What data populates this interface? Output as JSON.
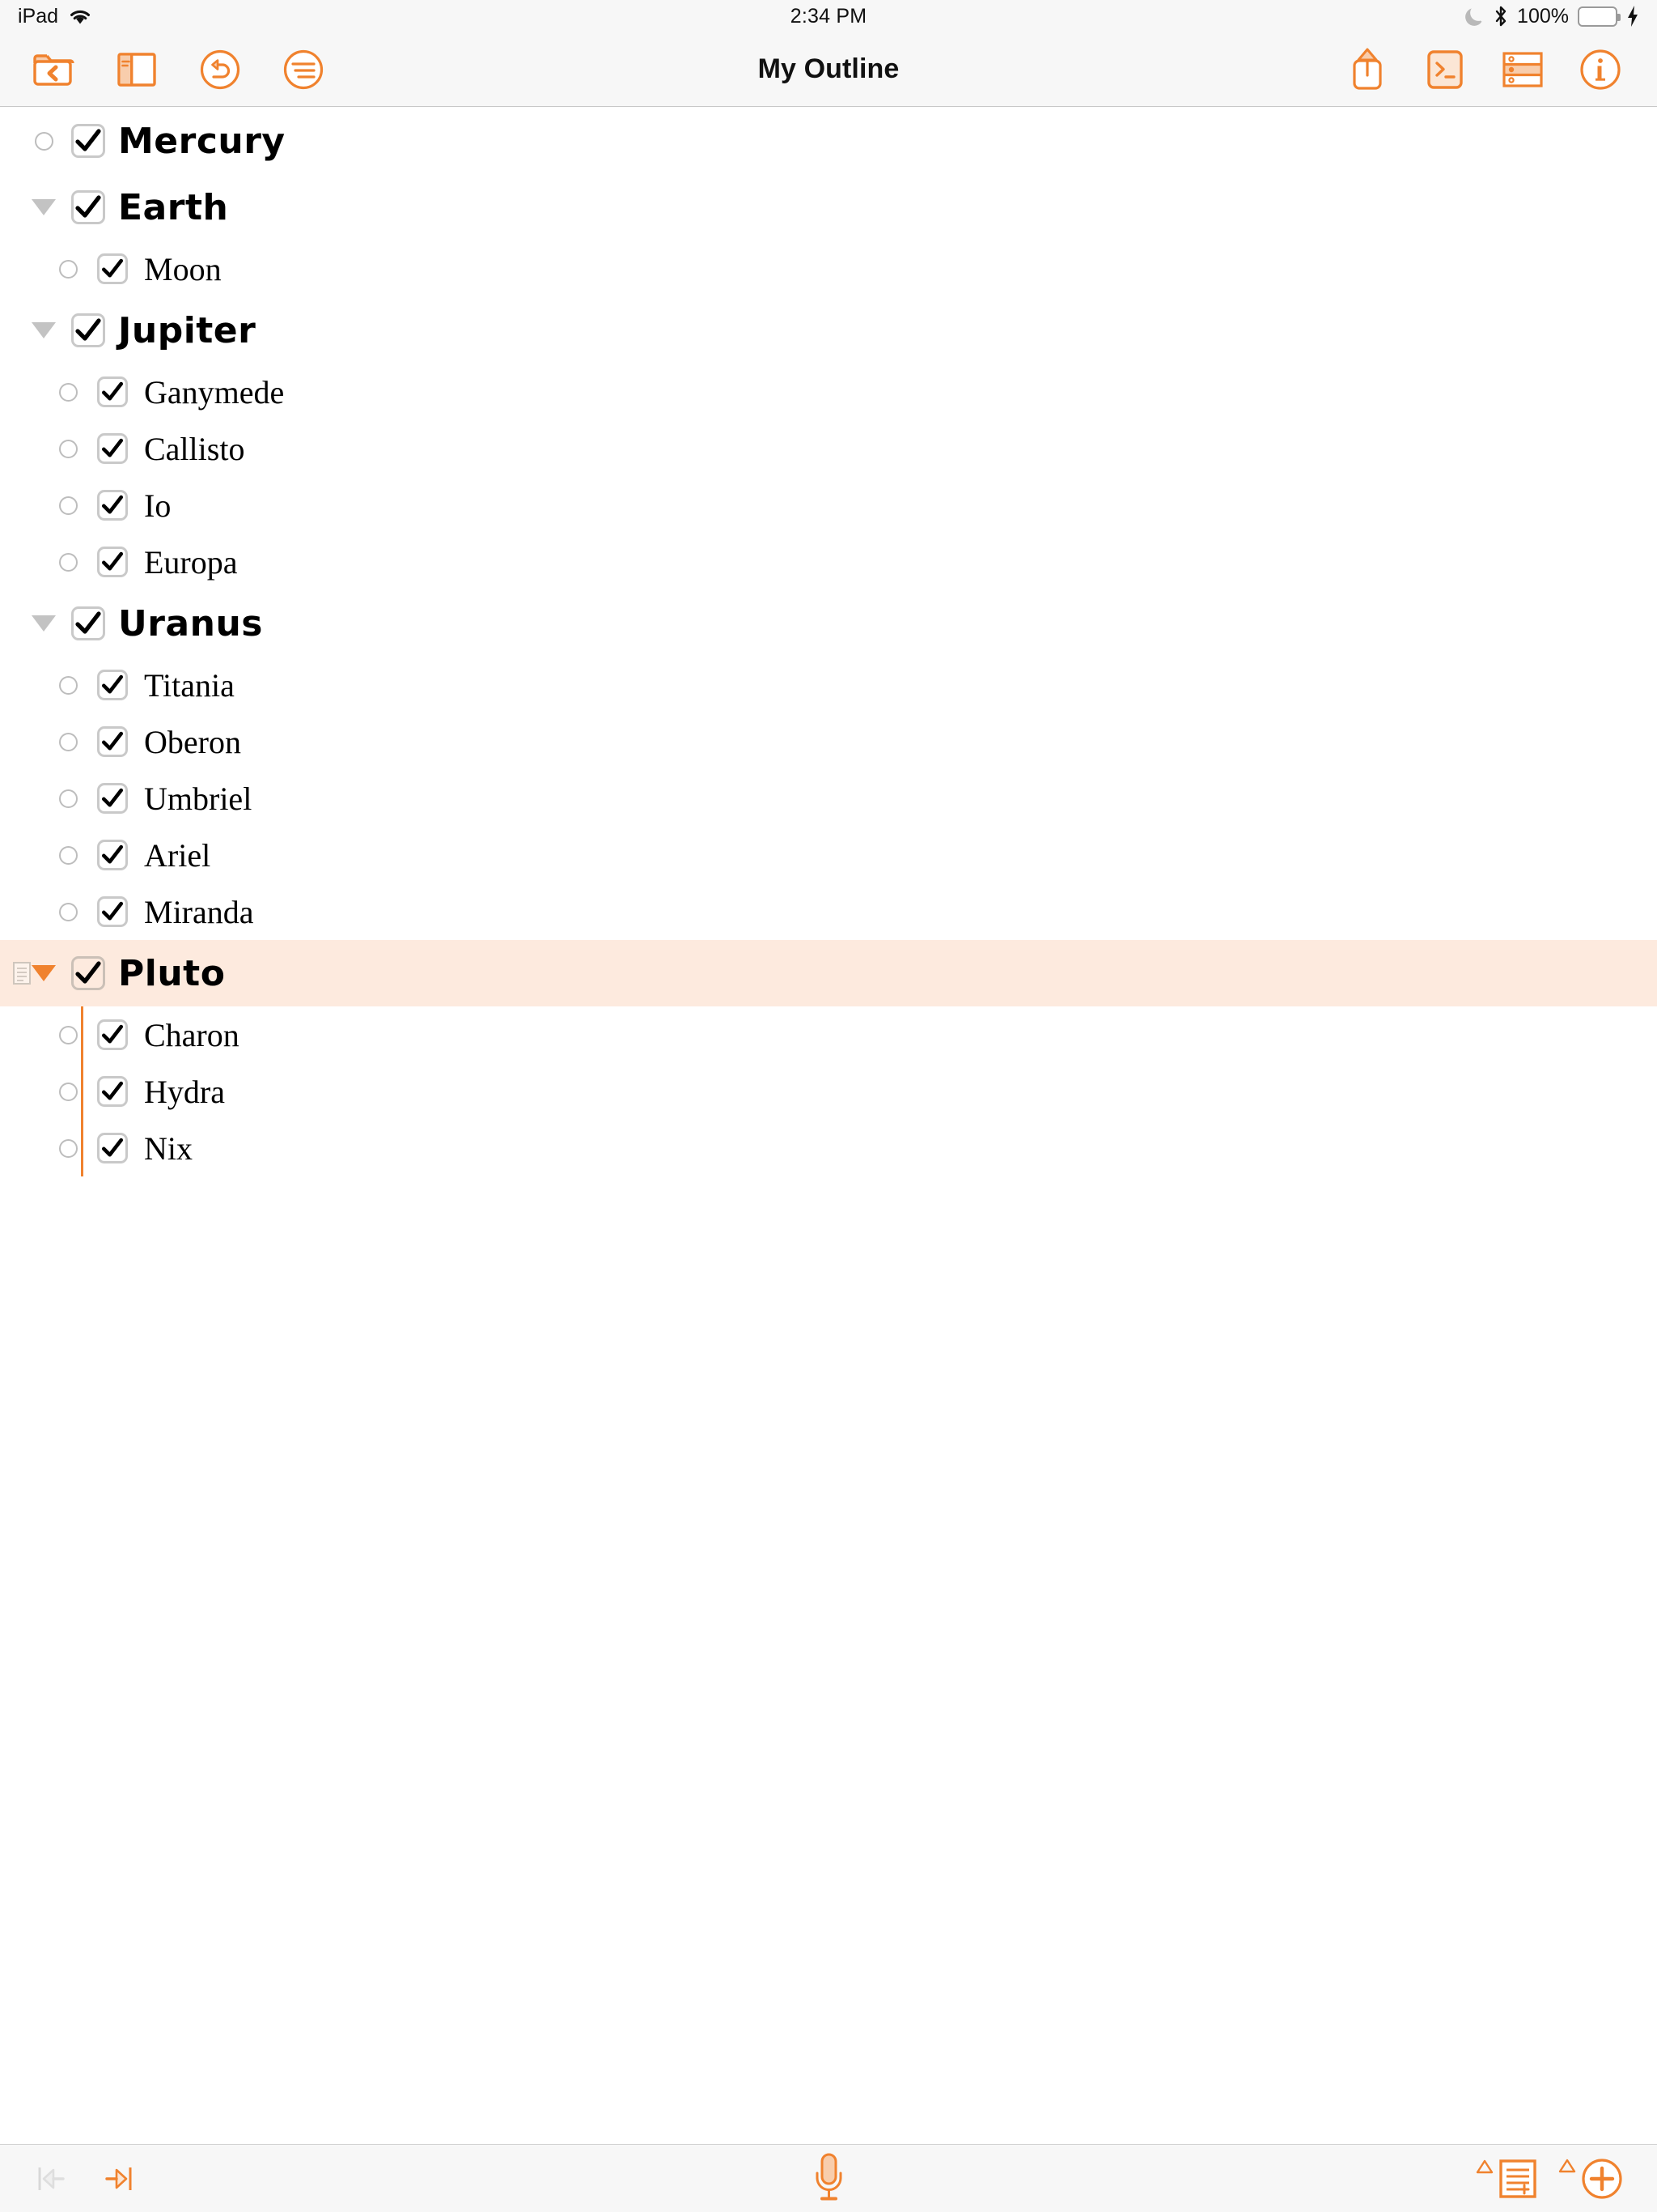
{
  "status_bar": {
    "device_label": "iPad",
    "wifi_icon": "wifi-icon",
    "time": "2:34 PM",
    "dnd_icon": "moon-icon",
    "bluetooth_icon": "bluetooth-icon",
    "battery_percent": "100%",
    "battery_icon": "battery-full-icon",
    "charging_icon": "lightning-bolt-icon"
  },
  "nav_bar": {
    "title": "My Outline",
    "left_buttons": [
      {
        "name": "back-to-documents-button",
        "icon": "folder-back-icon"
      },
      {
        "name": "toggle-sidebar-button",
        "icon": "sidebar-icon"
      },
      {
        "name": "undo-button",
        "icon": "undo-circle-icon"
      },
      {
        "name": "outline-format-button",
        "icon": "lines-circle-icon"
      }
    ],
    "right_buttons": [
      {
        "name": "share-button",
        "icon": "share-up-icon"
      },
      {
        "name": "script-console-button",
        "icon": "terminal-icon"
      },
      {
        "name": "row-select-button",
        "icon": "rows-icon"
      },
      {
        "name": "info-button",
        "icon": "info-circle-icon"
      }
    ]
  },
  "outline": {
    "accent_color": "#f0822e",
    "selection_background": "#fdeade",
    "checkbox_border_color": "#c9c9c9",
    "bullet_color": "#bdbdbd",
    "rows": [
      {
        "label": "Mercury",
        "level": 0,
        "checked": true,
        "handle": "bullet",
        "selected": false,
        "has_note": false
      },
      {
        "label": "Earth",
        "level": 0,
        "checked": true,
        "handle": "disclosure",
        "selected": false,
        "has_note": false
      },
      {
        "label": "Moon",
        "level": 1,
        "checked": true,
        "handle": "bullet",
        "selected": false,
        "has_note": false
      },
      {
        "label": "Jupiter",
        "level": 0,
        "checked": true,
        "handle": "disclosure",
        "selected": false,
        "has_note": false
      },
      {
        "label": "Ganymede",
        "level": 1,
        "checked": true,
        "handle": "bullet",
        "selected": false,
        "has_note": false
      },
      {
        "label": "Callisto",
        "level": 1,
        "checked": true,
        "handle": "bullet",
        "selected": false,
        "has_note": false
      },
      {
        "label": "Io",
        "level": 1,
        "checked": true,
        "handle": "bullet",
        "selected": false,
        "has_note": false
      },
      {
        "label": "Europa",
        "level": 1,
        "checked": true,
        "handle": "bullet",
        "selected": false,
        "has_note": false
      },
      {
        "label": "Uranus",
        "level": 0,
        "checked": true,
        "handle": "disclosure",
        "selected": false,
        "has_note": false
      },
      {
        "label": "Titania",
        "level": 1,
        "checked": true,
        "handle": "bullet",
        "selected": false,
        "has_note": false
      },
      {
        "label": "Oberon",
        "level": 1,
        "checked": true,
        "handle": "bullet",
        "selected": false,
        "has_note": false
      },
      {
        "label": "Umbriel",
        "level": 1,
        "checked": true,
        "handle": "bullet",
        "selected": false,
        "has_note": false
      },
      {
        "label": "Ariel",
        "level": 1,
        "checked": true,
        "handle": "bullet",
        "selected": false,
        "has_note": false
      },
      {
        "label": "Miranda",
        "level": 1,
        "checked": true,
        "handle": "bullet",
        "selected": false,
        "has_note": false
      },
      {
        "label": "Pluto",
        "level": 0,
        "checked": true,
        "handle": "disclosure",
        "selected": true,
        "has_note": true
      },
      {
        "label": "Charon",
        "level": 1,
        "checked": true,
        "handle": "bullet",
        "selected": false,
        "has_note": false
      },
      {
        "label": "Hydra",
        "level": 1,
        "checked": true,
        "handle": "bullet",
        "selected": false,
        "has_note": false
      },
      {
        "label": "Nix",
        "level": 1,
        "checked": true,
        "handle": "bullet",
        "selected": false,
        "has_note": false
      }
    ]
  },
  "bottom_bar": {
    "left_buttons": [
      {
        "name": "outdent-button",
        "icon": "outdent-icon",
        "enabled": false
      },
      {
        "name": "indent-button",
        "icon": "indent-icon",
        "enabled": true
      }
    ],
    "center_button": {
      "name": "dictation-button",
      "icon": "microphone-icon"
    },
    "right_buttons": [
      {
        "name": "add-note-button",
        "icon": "note-add-icon",
        "badge_icon": "triangle-up-icon"
      },
      {
        "name": "add-row-button",
        "icon": "plus-circle-icon",
        "badge_icon": "triangle-up-icon"
      }
    ]
  }
}
